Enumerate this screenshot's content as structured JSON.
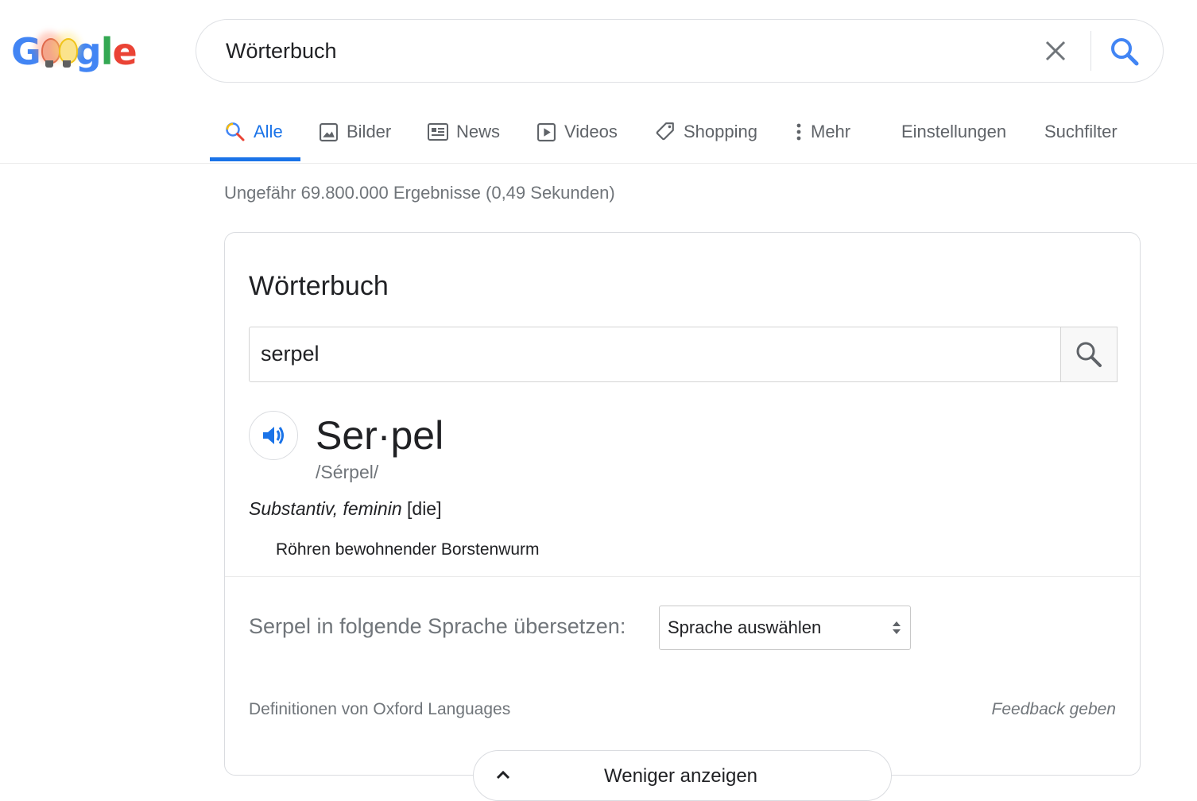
{
  "logo": {
    "letters": [
      "G",
      "g",
      "l",
      "e"
    ]
  },
  "search": {
    "query": "Wörterbuch"
  },
  "tabs": [
    {
      "label": "Alle",
      "icon": "search-icon"
    },
    {
      "label": "Bilder",
      "icon": "image-icon"
    },
    {
      "label": "News",
      "icon": "news-icon"
    },
    {
      "label": "Videos",
      "icon": "video-icon"
    },
    {
      "label": "Shopping",
      "icon": "tag-icon"
    },
    {
      "label": "Mehr",
      "icon": "more-vert-icon"
    },
    {
      "label": "Einstellungen"
    },
    {
      "label": "Suchfilter"
    }
  ],
  "stats": "Ungefähr 69.800.000 Ergebnisse (0,49 Sekunden)",
  "dictionary": {
    "title": "Wörterbuch",
    "input_value": "serpel",
    "headword": "Ser·pel",
    "phonetic": "/Sérpel/",
    "pos_italic": "Substantiv, feminin",
    "pos_article": "[die]",
    "definition": "Röhren bewohnender Borstenwurm",
    "translate_label": "Serpel in folgende Sprache übersetzen:",
    "language_select": "Sprache auswählen",
    "source": "Definitionen von Oxford Languages",
    "feedback": "Feedback geben"
  },
  "less_button": "Weniger anzeigen",
  "colors": {
    "accent": "#1a73e8",
    "muted": "#70757a"
  }
}
